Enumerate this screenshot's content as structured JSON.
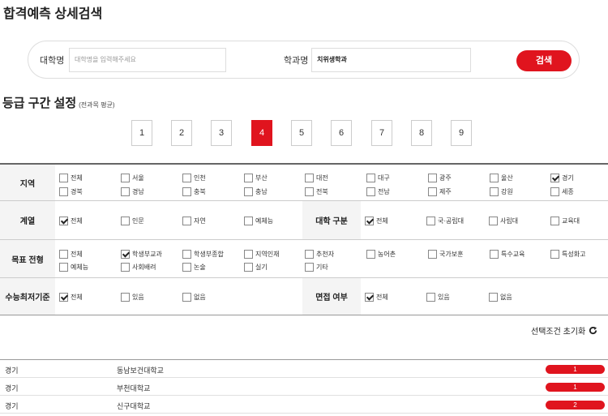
{
  "page_title": "합격예측 상세검색",
  "search": {
    "university_label": "대학명",
    "university_placeholder": "대학명을 입력해주세요",
    "major_label": "학과명",
    "major_value": "치위생학과",
    "search_button": "검색"
  },
  "grade": {
    "title": "등급 구간 설정",
    "subtitle": "(전과목 평균)",
    "levels": [
      "1",
      "2",
      "3",
      "4",
      "5",
      "6",
      "7",
      "8",
      "9"
    ],
    "selected": "4"
  },
  "filters": {
    "region": {
      "label": "지역",
      "options": [
        {
          "label": "전체",
          "checked": false
        },
        {
          "label": "서울",
          "checked": false
        },
        {
          "label": "인천",
          "checked": false
        },
        {
          "label": "부산",
          "checked": false
        },
        {
          "label": "대전",
          "checked": false
        },
        {
          "label": "대구",
          "checked": false
        },
        {
          "label": "광주",
          "checked": false
        },
        {
          "label": "울산",
          "checked": false
        },
        {
          "label": "경기",
          "checked": true
        },
        {
          "label": "경북",
          "checked": false
        },
        {
          "label": "경남",
          "checked": false
        },
        {
          "label": "충북",
          "checked": false
        },
        {
          "label": "충남",
          "checked": false
        },
        {
          "label": "전북",
          "checked": false
        },
        {
          "label": "전남",
          "checked": false
        },
        {
          "label": "제주",
          "checked": false
        },
        {
          "label": "강원",
          "checked": false
        },
        {
          "label": "세종",
          "checked": false
        }
      ]
    },
    "track": {
      "label": "계열",
      "options": [
        {
          "label": "전체",
          "checked": true
        },
        {
          "label": "인문",
          "checked": false
        },
        {
          "label": "자연",
          "checked": false
        },
        {
          "label": "예체능",
          "checked": false
        }
      ]
    },
    "univ_type": {
      "label": "대학 구분",
      "options": [
        {
          "label": "전체",
          "checked": true
        },
        {
          "label": "국·공립대",
          "checked": false
        },
        {
          "label": "사립대",
          "checked": false
        },
        {
          "label": "교육대",
          "checked": false
        }
      ]
    },
    "admission": {
      "label": "목표 전형",
      "options": [
        {
          "label": "전체",
          "checked": false
        },
        {
          "label": "학생부교과",
          "checked": true
        },
        {
          "label": "학생부종합",
          "checked": false
        },
        {
          "label": "지역인재",
          "checked": false
        },
        {
          "label": "추천자",
          "checked": false
        },
        {
          "label": "농어촌",
          "checked": false
        },
        {
          "label": "국가보훈",
          "checked": false
        },
        {
          "label": "특수교육",
          "checked": false
        },
        {
          "label": "특성화고",
          "checked": false
        },
        {
          "label": "예체능",
          "checked": false
        },
        {
          "label": "사회배려",
          "checked": false
        },
        {
          "label": "논술",
          "checked": false
        },
        {
          "label": "실기",
          "checked": false
        },
        {
          "label": "기타",
          "checked": false
        }
      ]
    },
    "csat_min": {
      "label": "수능최저기준",
      "options": [
        {
          "label": "전체",
          "checked": true
        },
        {
          "label": "있음",
          "checked": false
        },
        {
          "label": "없음",
          "checked": false
        }
      ]
    },
    "interview": {
      "label": "면접 여부",
      "options": [
        {
          "label": "전체",
          "checked": true
        },
        {
          "label": "있음",
          "checked": false
        },
        {
          "label": "없음",
          "checked": false
        }
      ]
    }
  },
  "reset_label": "선택조건 초기화",
  "results": [
    {
      "region": "경기",
      "name": "동남보건대학교",
      "value": "1"
    },
    {
      "region": "경기",
      "name": "부천대학교",
      "value": "1"
    },
    {
      "region": "경기",
      "name": "신구대학교",
      "value": "2"
    }
  ]
}
